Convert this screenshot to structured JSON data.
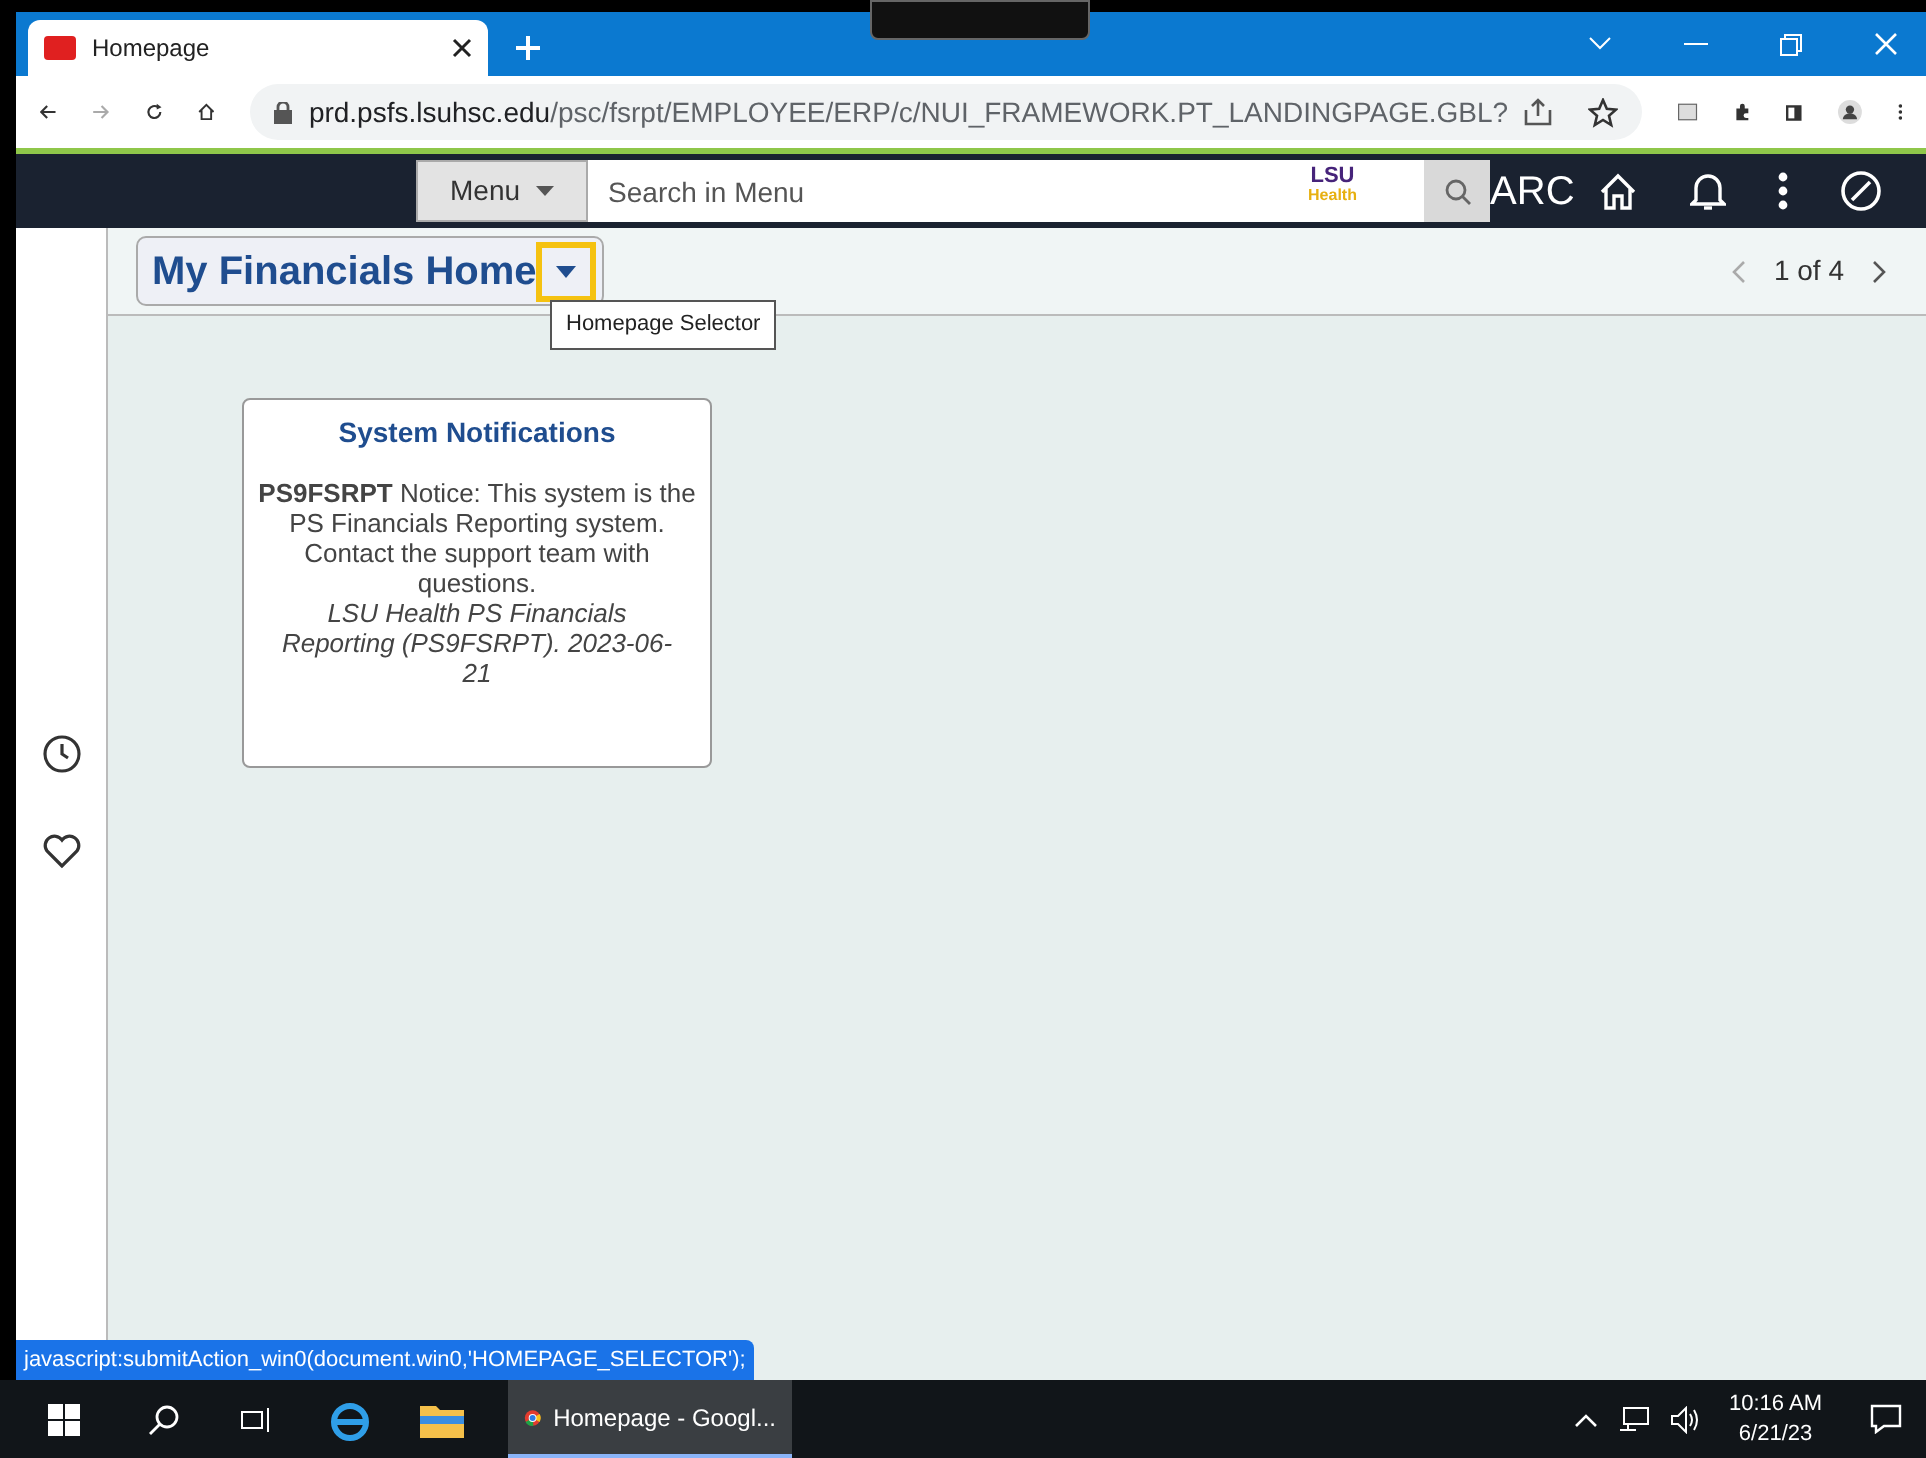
{
  "browser": {
    "tab_title": "Homepage",
    "url_host": "prd.psfs.lsuhsc.edu",
    "url_path": "/psc/fsrpt/EMPLOYEE/ERP/c/NUI_FRAMEWORK.PT_LANDINGPAGE.GBL?"
  },
  "app_header": {
    "menu_label": "Menu",
    "search_placeholder": "Search in Menu",
    "logo_top": "LSU",
    "logo_bottom": "Health",
    "partial_text": "ARC"
  },
  "page": {
    "title": "My Financials Home",
    "tooltip": "Homepage Selector",
    "pager": "1 of 4"
  },
  "tile": {
    "title": "System Notifications",
    "notice": "**PS9FSRPT** Notice: This system is the PS Financials Reporting system. Contact the support team with questions.",
    "source": "LSU Health PS Financials Reporting (PS9FSRPT). 2023-06-21"
  },
  "status_link": "javascript:submitAction_win0(document.win0,'HOMEPAGE_SELECTOR');",
  "taskbar": {
    "app_label": "Homepage - Googl...",
    "time": "10:16 AM",
    "date": "6/21/23"
  }
}
